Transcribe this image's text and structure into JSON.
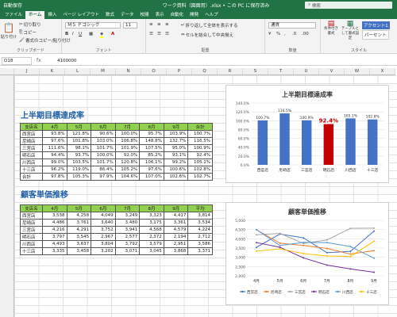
{
  "titlebar": {
    "autosave": "自動保存",
    "doc": "ワーク資料（図面用）.xlsx • この PC に保存済み",
    "search": "検索"
  },
  "tabs": [
    "ファイル",
    "ホーム",
    "挿入",
    "ページ レイアウト",
    "数式",
    "データ",
    "校閲",
    "表示",
    "自動化",
    "開発",
    "ヘルプ"
  ],
  "ribbon": {
    "paste": "貼り付け",
    "cut": "切り取り",
    "copy": "コピー",
    "format_painter": "書式のコピー/貼り付け",
    "clipboard": "クリップボード",
    "font_name": "ＭＳ Ｐゴシック",
    "font_size": "11",
    "font_group": "フォント",
    "wrap": "折り返して全体を表示する",
    "merge": "セルを結合して中央揃え",
    "align_group": "配置",
    "number_format": "通貨",
    "number_group": "数値",
    "cond_format": "条件付き書式",
    "table_format": "テーブルとして書式設定",
    "style_group": "スタイル",
    "accent": "アクセント1",
    "percent": "パーセント"
  },
  "formula": {
    "namebox": "O18",
    "fx": "fx",
    "value": "4100000"
  },
  "columns": [
    "J",
    "K",
    "L",
    "M",
    "N",
    "O",
    "P",
    "Q",
    "R",
    "S",
    "T",
    "U",
    "V",
    "W",
    "X"
  ],
  "section1": {
    "title": "上半期目標達成率",
    "headers": [
      "支店名",
      "4月",
      "5月",
      "6月",
      "7月",
      "8月",
      "9月",
      "合計"
    ],
    "rows": [
      [
        "西宮店",
        "93.8%",
        "121.8%",
        "90.6%",
        "100.0%",
        "95.7%",
        "103.9%",
        "100.7%"
      ],
      [
        "尼崎店",
        "97.6%",
        "101.8%",
        "103.0%",
        "106.8%",
        "148.8%",
        "132.7%",
        "116.5%"
      ],
      [
        "三宮店",
        "111.6%",
        "98.1%",
        "101.7%",
        "101.9%",
        "107.5%",
        "95.0%",
        "100.9%"
      ],
      [
        "明石店",
        "94.4%",
        "93.7%",
        "100.0%",
        "92.0%",
        "85.2%",
        "93.1%",
        "92.4%"
      ],
      [
        "川西店",
        "99.0%",
        "103.5%",
        "101.7%",
        "120.8%",
        "106.1%",
        "99.2%",
        "105.1%"
      ],
      [
        "十三店",
        "96.2%",
        "119.0%",
        "86.4%",
        "105.2%",
        "97.6%",
        "100.6%",
        "102.8%"
      ],
      [
        "合計",
        "97.8%",
        "105.3%",
        "97.9%",
        "104.6%",
        "107.0%",
        "102.6%",
        "102.7%"
      ]
    ]
  },
  "section2": {
    "title": "顧客単価推移",
    "headers": [
      "支店名",
      "4月",
      "5月",
      "6月",
      "7月",
      "8月",
      "9月",
      "平均"
    ],
    "rows": [
      [
        "西宮店",
        "3,538",
        "4,258",
        "4,049",
        "3,249",
        "3,323",
        "4,417",
        "3,814"
      ],
      [
        "尼崎店",
        "4,486",
        "3,761",
        "3,640",
        "3,480",
        "3,175",
        "3,361",
        "3,534"
      ],
      [
        "三宮店",
        "4,216",
        "4,291",
        "3,752",
        "3,941",
        "4,568",
        "4,579",
        "4,224"
      ],
      [
        "明石店",
        "3,797",
        "3,545",
        "2,967",
        "2,577",
        "2,372",
        "2,194",
        "2,712"
      ],
      [
        "川西店",
        "4,493",
        "3,637",
        "3,804",
        "3,792",
        "3,579",
        "2,951",
        "3,586"
      ],
      [
        "十三店",
        "3,335",
        "3,458",
        "3,202",
        "3,071",
        "3,045",
        "3,868",
        "3,371"
      ]
    ]
  },
  "chart_data": [
    {
      "type": "bar",
      "title": "上半期目標達成率",
      "categories": [
        "西宮店",
        "尼崎店",
        "三宮店",
        "明石店",
        "川西店",
        "十三店"
      ],
      "values": [
        100.7,
        116.5,
        100.9,
        92.4,
        105.1,
        102.8
      ],
      "labels": [
        "100.7%",
        "116.5%",
        "100.9%",
        "92.4%",
        "105.1%",
        "102.8%"
      ],
      "highlight_index": 3,
      "ylim": [
        0,
        140
      ],
      "yticks": [
        "0.0%",
        "20.0%",
        "40.0%",
        "60.0%",
        "80.0%",
        "100.0%",
        "120.0%",
        "140.0%"
      ],
      "colors": {
        "bar": "#4472c4",
        "highlight": "#c00000"
      }
    },
    {
      "type": "line",
      "title": "顧客単価推移",
      "categories": [
        "4月",
        "5月",
        "6月",
        "7月",
        "8月",
        "9月"
      ],
      "ylim": [
        2000,
        5000
      ],
      "yticks": [
        "2,000",
        "2,500",
        "3,000",
        "3,500",
        "4,000",
        "4,500",
        "5,000"
      ],
      "series": [
        {
          "name": "西宮店",
          "values": [
            3538,
            4258,
            4049,
            3249,
            3323,
            4417
          ],
          "color": "#4472c4"
        },
        {
          "name": "尼崎店",
          "values": [
            4486,
            3761,
            3640,
            3480,
            3175,
            3361
          ],
          "color": "#ed7d31"
        },
        {
          "name": "三宮店",
          "values": [
            4216,
            4291,
            3752,
            3941,
            4568,
            4579
          ],
          "color": "#a5a5a5"
        },
        {
          "name": "明石店",
          "values": [
            3797,
            3545,
            2967,
            2577,
            2372,
            2194
          ],
          "color": "#7030a0"
        },
        {
          "name": "川西店",
          "values": [
            4493,
            3637,
            3804,
            3792,
            3579,
            2951
          ],
          "color": "#5b9bd5"
        },
        {
          "name": "十三店",
          "values": [
            3335,
            3458,
            3202,
            3071,
            3045,
            3868
          ],
          "color": "#ffc000"
        }
      ]
    }
  ]
}
